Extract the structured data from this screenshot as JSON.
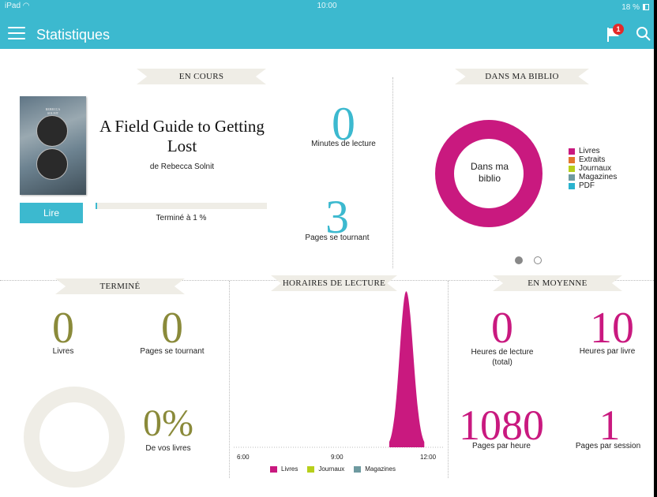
{
  "status_bar": {
    "device": "iPad",
    "time": "10:00",
    "battery": "18 %"
  },
  "header": {
    "title": "Statistiques",
    "notification_count": "1",
    "colors": {
      "bar": "#3cb9cf"
    }
  },
  "en_cours": {
    "banner": "EN COURS",
    "book_title": "A Field Guide to Getting Lost",
    "author": "de Rebecca Solnit",
    "read_button": "Lire",
    "progress_fraction": 0.01,
    "progress_label": "Terminé à 1 %",
    "minutes_value": "0",
    "minutes_label": "Minutes de lecture",
    "pages_value": "3",
    "pages_label": "Pages se tournant"
  },
  "biblio": {
    "banner": "DANS MA BIBLIO",
    "donut_label_1": "Dans ma",
    "donut_label_2": "biblio",
    "legend": [
      {
        "label": "Livres",
        "color": "#c9197f"
      },
      {
        "label": "Extraits",
        "color": "#e2762d"
      },
      {
        "label": "Journaux",
        "color": "#b7cf1b"
      },
      {
        "label": "Magazines",
        "color": "#6e9aa0"
      },
      {
        "label": "PDF",
        "color": "#2ab3cf"
      }
    ],
    "page_indicator": {
      "pages": 2,
      "current": 1
    }
  },
  "termine": {
    "banner": "TERMINÉ",
    "books_value": "0",
    "books_label": "Livres",
    "pages_value": "0",
    "pages_label": "Pages se tournant",
    "percent_value": "0%",
    "percent_label": "De vos livres",
    "colors": {
      "number": "#8a8a3a",
      "ring": "#efede6"
    }
  },
  "horaires": {
    "banner": "HORAIRES DE LECTURE",
    "legend": [
      {
        "label": "Livres",
        "color": "#c9197f"
      },
      {
        "label": "Journaux",
        "color": "#b7cf1b"
      },
      {
        "label": "Magazines",
        "color": "#6e9aa0"
      }
    ]
  },
  "chart_data": {
    "type": "area",
    "x_ticks": [
      "6:00",
      "9:00",
      "12:00"
    ],
    "xlim": [
      "6:00",
      "12:00"
    ],
    "series": [
      {
        "name": "Livres",
        "color": "#c9197f",
        "peak_x": "11:03",
        "start_x": "10:32",
        "end_x": "11:36",
        "peak_relative": 1.0
      }
    ],
    "grid": false,
    "legend_position": "bottom"
  },
  "moyenne": {
    "banner": "EN MOYENNE",
    "hours_value": "0",
    "hours_label_1": "Heures de lecture",
    "hours_label_2": "(total)",
    "hours_per_book_value": "10",
    "hours_per_book_label": "Heures par livre",
    "pages_per_hour_value": "1080",
    "pages_per_hour_label": "Pages par heure",
    "pages_per_session_value": "1",
    "pages_per_session_label": "Pages par session",
    "colors": {
      "number": "#c9197f"
    }
  }
}
